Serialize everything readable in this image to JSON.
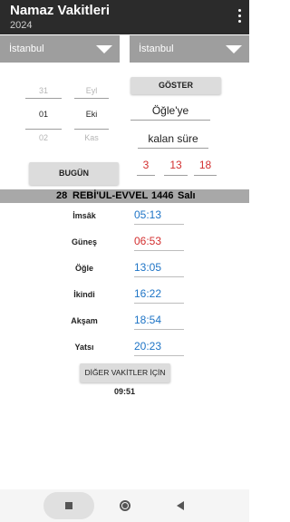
{
  "app": {
    "title": "Namaz Vakitleri",
    "subtitle": "2024"
  },
  "selectors": {
    "left_value": "İstanbul",
    "right_value": "İstanbul"
  },
  "date_picker": {
    "day": {
      "prev": "31",
      "current": "01",
      "next": "02"
    },
    "month": {
      "prev": "Eyl",
      "current": "Eki",
      "next": "Kas"
    }
  },
  "buttons": {
    "goster": "GÖSTER",
    "bugun": "BUGÜN",
    "diger": "DİĞER VAKİTLER İÇİN"
  },
  "countdown": {
    "target_label": "Öğle'ye",
    "remaining_label": "kalan süre",
    "hours": "3",
    "minutes": "13",
    "seconds": "18"
  },
  "hijri_date": {
    "day": "28",
    "month": "REBİ'UL-EVVEL",
    "year": "1446",
    "weekday": "Salı"
  },
  "prayers": [
    {
      "name": "İmsâk",
      "time": "05:13"
    },
    {
      "name": "Güneş",
      "time": "06:53"
    },
    {
      "name": "Öğle",
      "time": "13:05"
    },
    {
      "name": "İkindi",
      "time": "16:22"
    },
    {
      "name": "Akşam",
      "time": "18:54"
    },
    {
      "name": "Yatsı",
      "time": "20:23"
    }
  ],
  "clock": "09:51",
  "colors": {
    "appbar": "#2b2b2b",
    "spinner": "#9e9e9e",
    "time_blue": "#1e74c6",
    "time_red": "#d32f2f",
    "date_bar": "#a8a8a8"
  },
  "icons": {
    "menu": "more-vert-icon",
    "dropdown": "triangle-down-icon",
    "nav_recent": "square-icon",
    "nav_home": "circle-icon",
    "nav_back": "triangle-left-icon"
  }
}
